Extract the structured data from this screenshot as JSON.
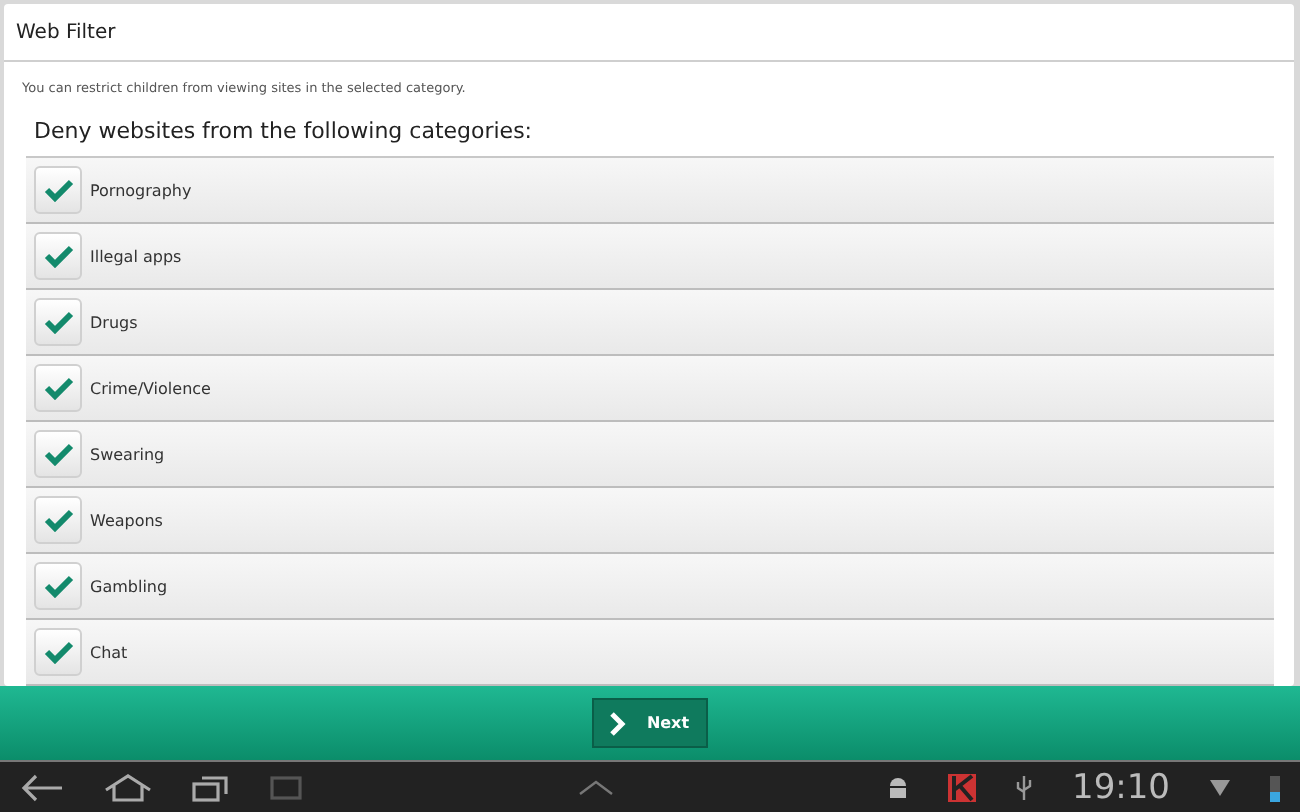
{
  "window": {
    "title": "Web Filter"
  },
  "description": "You can restrict children from viewing sites in the selected category.",
  "heading": "Deny websites from the following categories:",
  "categories": [
    {
      "label": "Pornography",
      "checked": true
    },
    {
      "label": "Illegal apps",
      "checked": true
    },
    {
      "label": "Drugs",
      "checked": true
    },
    {
      "label": "Crime/Violence",
      "checked": true
    },
    {
      "label": "Swearing",
      "checked": true
    },
    {
      "label": "Weapons",
      "checked": true
    },
    {
      "label": "Gambling",
      "checked": true
    },
    {
      "label": "Chat",
      "checked": true
    }
  ],
  "next_button": {
    "label": "Next"
  },
  "status_bar": {
    "time": "19:10"
  }
}
